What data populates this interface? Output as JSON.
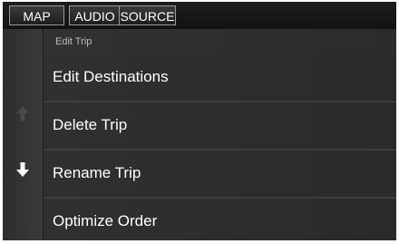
{
  "tabs": {
    "map": "MAP",
    "audio": "AUDIO",
    "source": "SOURCE"
  },
  "header": {
    "title": "Edit Trip"
  },
  "menu": {
    "items": [
      {
        "label": "Edit Destinations"
      },
      {
        "label": "Delete Trip"
      },
      {
        "label": "Rename Trip"
      },
      {
        "label": "Optimize Order"
      }
    ]
  },
  "scroll": {
    "up_icon": "arrow-up-icon",
    "up_state": "disabled",
    "down_icon": "arrow-down-icon",
    "down_state": "enabled"
  },
  "colors": {
    "background": "#2b2b2b",
    "text": "#ffffff",
    "header_text": "#bdbdbd"
  }
}
